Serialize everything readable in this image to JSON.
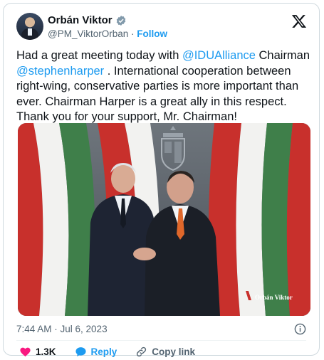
{
  "author": {
    "name": "Orbán Viktor",
    "handle": "@PM_ViktorOrban",
    "separator": "·",
    "follow_label": "Follow"
  },
  "tweet": {
    "segments": [
      "Had a great meeting today with ",
      "@IDUAlliance",
      " Chairman ",
      "@stephenharper",
      " . International cooperation between right-wing, conservative parties is more important than ever. Chairman Harper is a great ally in this respect. Thank you for your support, Mr. Chairman!"
    ]
  },
  "media": {
    "watermark": "Orbán Viktor"
  },
  "timestamp": "7:44 AM · Jul 6, 2023",
  "actions": {
    "like_count": "1.3K",
    "reply_label": "Reply",
    "copy_label": "Copy link"
  },
  "colors": {
    "accent": "#1d9bf0",
    "like": "#f91880",
    "text": "#0f1419",
    "muted": "#536471",
    "flag_red": "#c8302c",
    "flag_green": "#3f7f4a"
  },
  "icons": [
    "verified-badge-icon",
    "x-logo-icon",
    "info-icon",
    "heart-icon",
    "reply-bubble-icon",
    "link-icon"
  ]
}
